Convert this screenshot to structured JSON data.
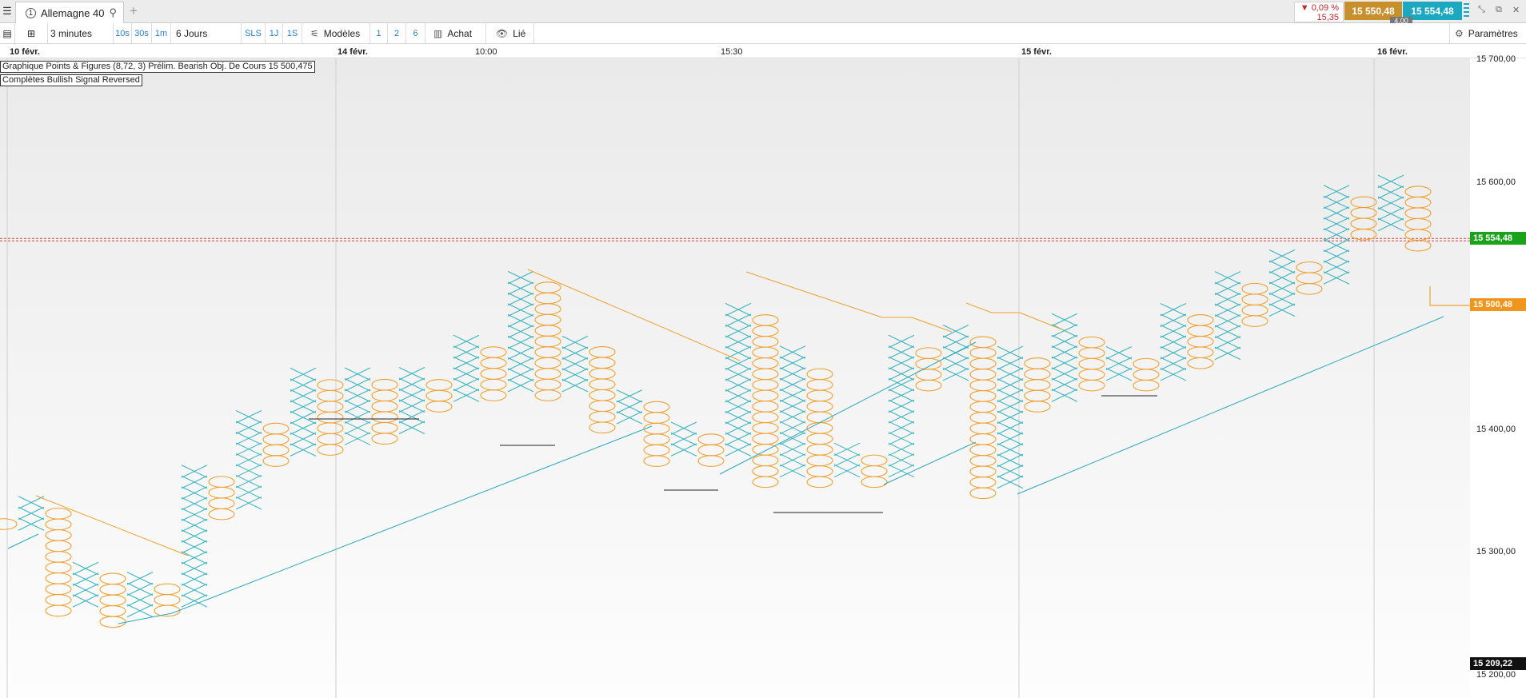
{
  "tab": {
    "number": "1",
    "title": "Allemagne 40"
  },
  "quote": {
    "change_pct": "0,09 %",
    "change_pts": "15,35",
    "bid": "15 550,48",
    "ask": "15 554,48",
    "spread": "4,00",
    "down_color": "#c0282c",
    "bid_color": "#c8902c",
    "ask_color": "#1ba8c0"
  },
  "toolbar": {
    "interval": "3 minutes",
    "quick_intervals": [
      "10s",
      "30s",
      "1m"
    ],
    "range": "6 Jours",
    "quick_ranges": [
      "SLS",
      "1J",
      "1S"
    ],
    "models_label": "Modèles",
    "layouts": [
      "1",
      "2",
      "6"
    ],
    "buy_label": "Achat",
    "linked_label": "Lié",
    "settings_label": "Paramètres"
  },
  "time_axis": {
    "labels": [
      {
        "text": "10 févr.",
        "bold": true
      },
      {
        "text": "14 févr.",
        "bold": true
      },
      {
        "text": "10:00",
        "bold": false
      },
      {
        "text": "15:30",
        "bold": false
      },
      {
        "text": "15 févr.",
        "bold": true
      },
      {
        "text": "16 févr.",
        "bold": true
      }
    ]
  },
  "info": {
    "line1": "Graphique Points & Figures (8,72, 3)    Prélim. Bearish Obj. De Cours 15 500,475",
    "line2": "Complètes Bullish Signal Reversed"
  },
  "price_axis": {
    "ticks": [
      "15 700,00",
      "15 600,00",
      "15 400,00",
      "15 300,00",
      "15 200,00"
    ],
    "current_price": "15 554,48",
    "target_price": "15 500,48",
    "low_price": "15 209,22",
    "current_color": "#1aa31a",
    "target_color": "#f0961e",
    "low_color": "#111111"
  },
  "chart_data": {
    "type": "point-and-figure",
    "box_size": 8.72,
    "reversal": 3,
    "ylim": [
      15200,
      15700
    ],
    "x_color": "#3ab5c0",
    "o_color": "#f0a030",
    "columns": [
      {
        "type": "O",
        "high": 15325,
        "low": 15325
      },
      {
        "type": "X",
        "low": 15325,
        "high": 15342
      },
      {
        "type": "O",
        "high": 15333,
        "low": 15255
      },
      {
        "type": "X",
        "low": 15263,
        "high": 15290
      },
      {
        "type": "O",
        "high": 15281,
        "low": 15246
      },
      {
        "type": "X",
        "low": 15255,
        "high": 15281
      },
      {
        "type": "O",
        "high": 15272,
        "low": 15255
      },
      {
        "type": "X",
        "low": 15263,
        "high": 15368
      },
      {
        "type": "O",
        "high": 15359,
        "low": 15333
      },
      {
        "type": "X",
        "low": 15342,
        "high": 15411
      },
      {
        "type": "O",
        "high": 15403,
        "low": 15376
      },
      {
        "type": "X",
        "low": 15385,
        "high": 15446
      },
      {
        "type": "O",
        "high": 15437,
        "low": 15385
      },
      {
        "type": "X",
        "low": 15394,
        "high": 15446
      },
      {
        "type": "O",
        "high": 15437,
        "low": 15394
      },
      {
        "type": "X",
        "low": 15403,
        "high": 15446
      },
      {
        "type": "O",
        "high": 15437,
        "low": 15420
      },
      {
        "type": "X",
        "low": 15429,
        "high": 15472
      },
      {
        "type": "O",
        "high": 15463,
        "low": 15429
      },
      {
        "type": "X",
        "low": 15437,
        "high": 15524
      },
      {
        "type": "O",
        "high": 15515,
        "low": 15429
      },
      {
        "type": "X",
        "low": 15437,
        "high": 15472
      },
      {
        "type": "O",
        "high": 15463,
        "low": 15403
      },
      {
        "type": "X",
        "low": 15411,
        "high": 15429
      },
      {
        "type": "O",
        "high": 15420,
        "low": 15376
      },
      {
        "type": "X",
        "low": 15385,
        "high": 15403
      },
      {
        "type": "O",
        "high": 15394,
        "low": 15376
      },
      {
        "type": "X",
        "low": 15385,
        "high": 15498
      },
      {
        "type": "O",
        "high": 15489,
        "low": 15359
      },
      {
        "type": "X",
        "low": 15368,
        "high": 15463
      },
      {
        "type": "O",
        "high": 15446,
        "low": 15359
      },
      {
        "type": "X",
        "low": 15368,
        "high": 15385
      },
      {
        "type": "O",
        "high": 15376,
        "low": 15359
      },
      {
        "type": "X",
        "low": 15368,
        "high": 15472
      },
      {
        "type": "O",
        "high": 15463,
        "low": 15437
      },
      {
        "type": "X",
        "low": 15446,
        "high": 15481
      },
      {
        "type": "O",
        "high": 15472,
        "low": 15350
      },
      {
        "type": "X",
        "low": 15359,
        "high": 15463
      },
      {
        "type": "O",
        "high": 15455,
        "low": 15420
      },
      {
        "type": "X",
        "low": 15429,
        "high": 15489
      },
      {
        "type": "O",
        "high": 15472,
        "low": 15437
      },
      {
        "type": "X",
        "low": 15446,
        "high": 15463
      },
      {
        "type": "O",
        "high": 15455,
        "low": 15437
      },
      {
        "type": "X",
        "low": 15446,
        "high": 15498
      },
      {
        "type": "O",
        "high": 15489,
        "low": 15455
      },
      {
        "type": "X",
        "low": 15463,
        "high": 15524
      },
      {
        "type": "O",
        "high": 15515,
        "low": 15489
      },
      {
        "type": "X",
        "low": 15498,
        "high": 15541
      },
      {
        "type": "O",
        "high": 15533,
        "low": 15515
      },
      {
        "type": "X",
        "low": 15524,
        "high": 15594
      },
      {
        "type": "O",
        "high": 15585,
        "low": 15559
      },
      {
        "type": "X",
        "low": 15567,
        "high": 15602
      },
      {
        "type": "O",
        "high": 15594,
        "low": 15550
      }
    ]
  }
}
